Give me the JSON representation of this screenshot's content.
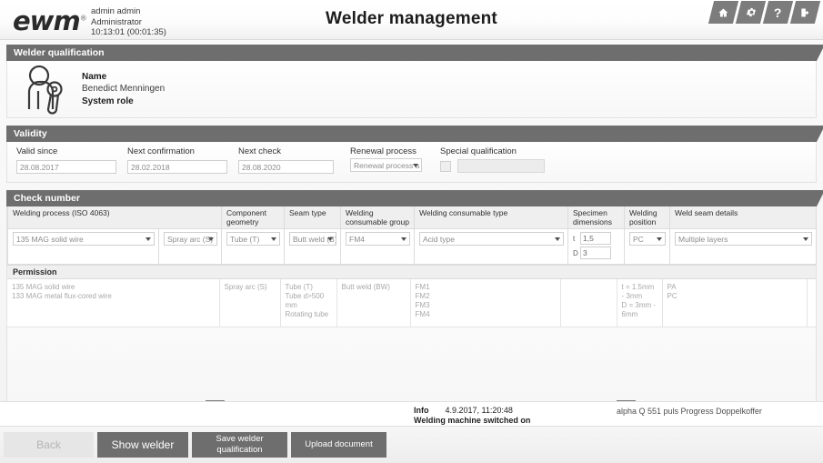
{
  "header": {
    "logo": "ewm",
    "logo_tm": "®",
    "user_name": "admin admin",
    "user_role": "Administrator",
    "user_time": "10:13:01 (00:01:35)",
    "title": "Welder management",
    "nav": [
      {
        "name": "home-icon",
        "label": "Home"
      },
      {
        "name": "settings-icon",
        "label": "Settings"
      },
      {
        "name": "help-icon",
        "label": "?"
      },
      {
        "name": "logout-icon",
        "label": "Logout"
      }
    ]
  },
  "welder_qualification": {
    "section_title": "Welder qualification",
    "name_label": "Name",
    "name_value": "Benedict Menningen",
    "role_label": "System role",
    "role_value": ""
  },
  "validity": {
    "section_title": "Validity",
    "fields": [
      {
        "label": "Valid since",
        "value": "28.08.2017"
      },
      {
        "label": "Next confirmation",
        "value": "28.02.2018"
      },
      {
        "label": "Next check",
        "value": "28.08.2020"
      }
    ],
    "renewal": {
      "label": "Renewal process",
      "value": "Renewal process a"
    },
    "special": {
      "label": "Special qualification",
      "checked": false,
      "value": ""
    }
  },
  "check_number": {
    "section_title": "Check number",
    "columns": [
      "Welding process (ISO 4063)",
      "Component geometry",
      "Seam type",
      "Welding consumable group",
      "Welding consumable type",
      "Specimen dimensions",
      "Welding position",
      "Weld seam details"
    ],
    "selected": {
      "welding_process": "135 MAG solid wire",
      "arc_type": "Spray arc (S)",
      "component_geometry": "Tube (T)",
      "seam_type": "Butt weld (B)",
      "consumable_group": "FM4",
      "consumable_type": "Acid type",
      "specimen_t_label": "t",
      "specimen_t_value": "1,5",
      "specimen_d_label": "D",
      "specimen_d_value": "3",
      "welding_position": "PC",
      "weld_seam_details": "Multiple layers"
    },
    "permission_title": "Permission",
    "permission": {
      "welding_process": "135 MAG solid wire\n133 MAG metal flux-cored wire",
      "arc_type": "Spray arc (S)",
      "component_geometry": "Tube (T)\nTube d>500 mm\nRotating tube",
      "seam_type": "Butt weld (BW)",
      "consumable_group": "FM1\nFM2\nFM3\nFM4",
      "consumable_type": "",
      "specimen_dimensions": "t = 1.5mm - 3mm\nD = 3mm - 6mm",
      "welding_position": "PA\nPC",
      "weld_seam_details": ""
    }
  },
  "status_bar": {
    "info_label": "Info",
    "timestamp": "4.9.2017, 11:20:48",
    "message": "Welding machine switched on",
    "machine": "alpha Q 551 puls Progress Doppelkoffer"
  },
  "footer": {
    "buttons": [
      {
        "label": "Back",
        "disabled": true
      },
      {
        "label": "Show welder",
        "disabled": false
      },
      {
        "label": "Save welder\nqualification",
        "disabled": false
      },
      {
        "label": "Upload document",
        "disabled": false
      }
    ]
  },
  "colors": {
    "section_header": "#6e6e6e",
    "button": "#6e6e6e",
    "button_disabled": "#e6e6e6",
    "grid_header": "#efefef",
    "permission_text": "#a8a8a8"
  }
}
